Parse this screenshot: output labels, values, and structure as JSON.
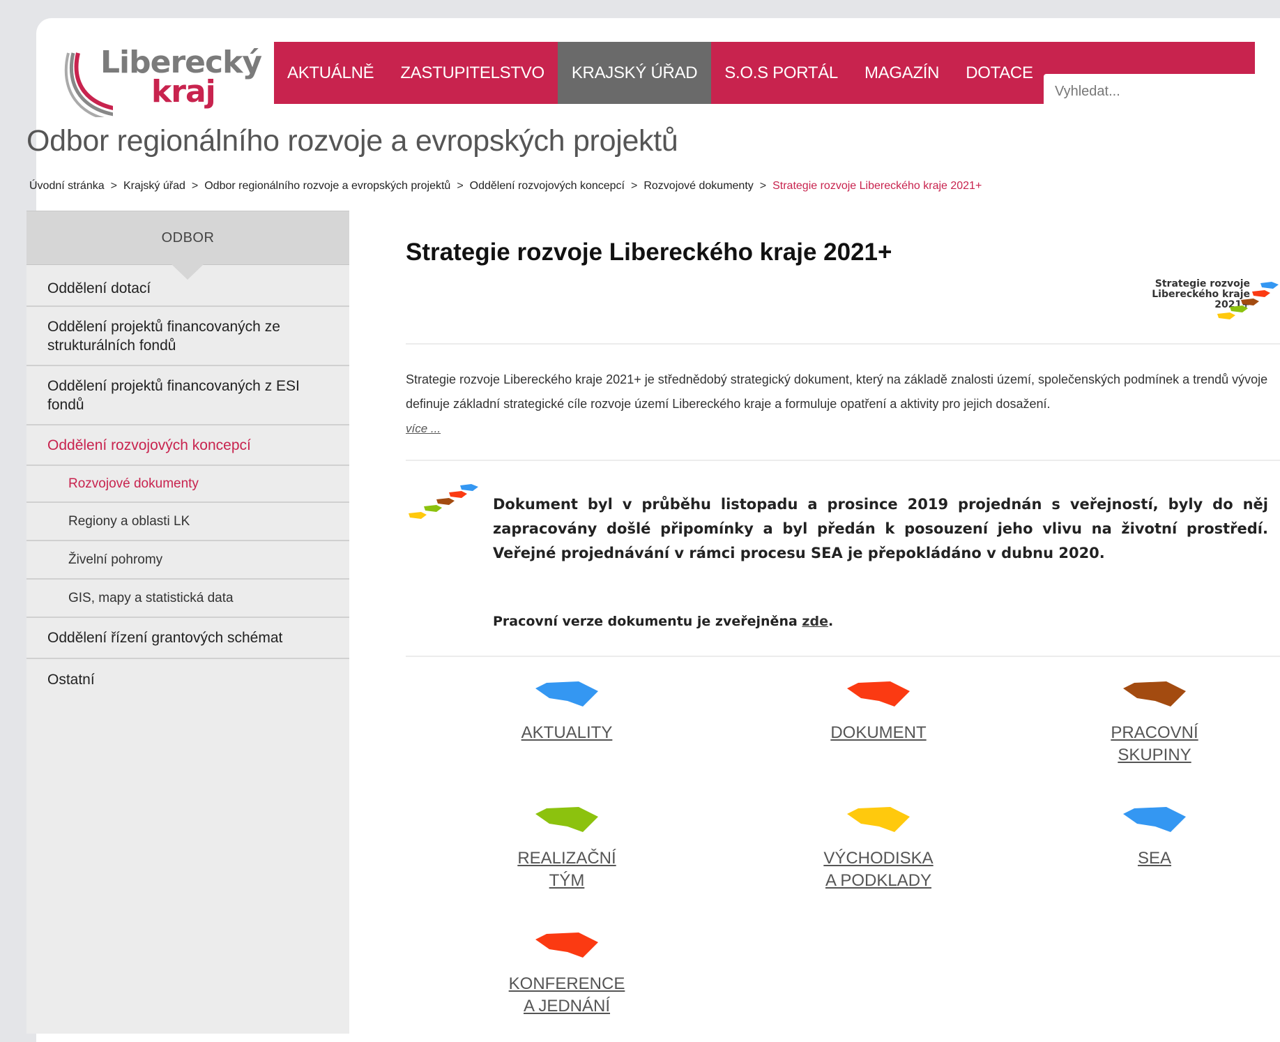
{
  "brand": {
    "logo_line1": "Liberecký",
    "logo_line2": "kraj",
    "color_primary": "#c8234e"
  },
  "nav": {
    "items": [
      "AKTUÁLNĚ",
      "ZASTUPITELSTVO",
      "KRAJSKÝ ÚŘAD",
      "S.O.S PORTÁL",
      "MAGAZÍN",
      "DOTACE"
    ],
    "active_index": 2,
    "search_placeholder": "Vyhledat..."
  },
  "page": {
    "title": "Odbor regionálního rozvoje a evropských projektů",
    "breadcrumb": [
      "Úvodní stránka",
      "Krajský úřad",
      "Odbor regionálního rozvoje a evropských projektů",
      "Oddělení rozvojových koncepcí",
      "Rozvojové dokumenty",
      "Strategie rozvoje Libereckého kraje 2021+"
    ],
    "breadcrumb_sep": ">"
  },
  "sidebar": {
    "heading": "ODBOR",
    "items": [
      {
        "label": "Oddělení dotací"
      },
      {
        "label": "Oddělení projektů financovaných ze strukturálních fondů"
      },
      {
        "label": "Oddělení projektů financovaných z ESI fondů"
      },
      {
        "label": "Oddělení rozvojových koncepcí"
      },
      {
        "label": "Rozvojové dokumenty"
      },
      {
        "label": "Regiony a oblasti LK"
      },
      {
        "label": "Živelní pohromy"
      },
      {
        "label": "GIS, mapy a statistická data"
      },
      {
        "label": "Oddělení řízení grantových schémat"
      },
      {
        "label": "Ostatní"
      }
    ]
  },
  "main": {
    "title": "Strategie rozvoje Libereckého kraje 2021+",
    "strategy_logo_text": "Strategie rozvoje Libereckého kraje 2021+",
    "intro": "Strategie rozvoje Libereckého kraje 2021+ je střednědobý strategický dokument, který na základě znalosti území, společenských podmínek a trendů vývoje definuje základní strategické cíle rozvoje území Libereckého kraje a formuluje opatření a aktivity pro jejich dosažení.",
    "more": "více ...",
    "notice": "Dokument byl v průběhu listopadu a prosince 2019 projednán s veřejností, byly do něj zapracovány došlé připomínky a byl předán k posouzení jeho vlivu na životní prostředí. Veřejné projednávání v rámci procesu SEA je přepokládáno v dubnu 2020.",
    "work_prefix": "Pracovní verze dokumentu je zveřejněna ",
    "work_link": "zde",
    "work_suffix": ".",
    "tiles": [
      {
        "line1": "AKTUALITY",
        "line2": "",
        "color": "#3497f2"
      },
      {
        "line1": "DOKUMENT",
        "line2": "",
        "color": "#fb3a12"
      },
      {
        "line1": "PRACOVNÍ",
        "line2": "SKUPINY",
        "color": "#a34b10"
      },
      {
        "line1": "REALIZAČNÍ",
        "line2": "TÝM",
        "color": "#8cc20e"
      },
      {
        "line1": "VÝCHODISKA",
        "line2": "A PODKLADY",
        "color": "#ffc90d"
      },
      {
        "line1": "SEA",
        "line2": "",
        "color": "#3497f2"
      },
      {
        "line1": "KONFERENCE",
        "line2": "A JEDNÁNÍ",
        "color": "#fb3a12"
      }
    ]
  }
}
